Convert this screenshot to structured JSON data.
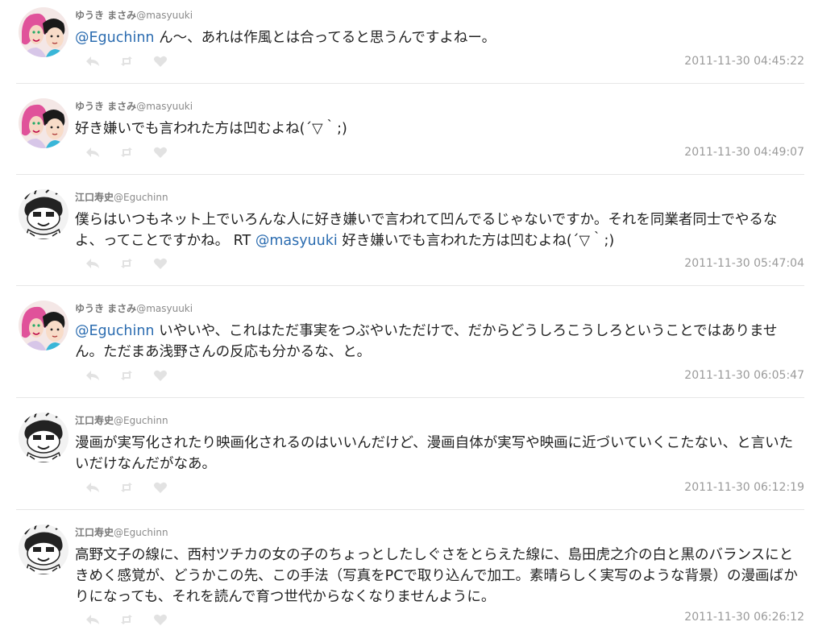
{
  "tweets": [
    {
      "name": "ゆうき まさみ",
      "handle": "@masyuuki",
      "avatar": "masyuuki",
      "parts": [
        {
          "type": "mention",
          "text": "@Eguchinn"
        },
        {
          "type": "text",
          "text": " ん〜、あれは作風とは合ってると思うんですよねー。"
        }
      ],
      "time": "2011-11-30 04:45:22"
    },
    {
      "name": "ゆうき まさみ",
      "handle": "@masyuuki",
      "avatar": "masyuuki",
      "parts": [
        {
          "type": "text",
          "text": "好き嫌いでも言われた方は凹むよね(´▽｀;)"
        }
      ],
      "time": "2011-11-30 04:49:07"
    },
    {
      "name": "江口寿史",
      "handle": "@Eguchinn",
      "avatar": "eguchinn",
      "parts": [
        {
          "type": "text",
          "text": "僕らはいつもネット上でいろんな人に好き嫌いで言われて凹んでるじゃないですか。それを同業者同士でやるなよ、ってことですかね。 RT "
        },
        {
          "type": "mention",
          "text": "@masyuuki"
        },
        {
          "type": "text",
          "text": " 好き嫌いでも言われた方は凹むよね(´▽｀;)"
        }
      ],
      "time": "2011-11-30 05:47:04"
    },
    {
      "name": "ゆうき まさみ",
      "handle": "@masyuuki",
      "avatar": "masyuuki",
      "parts": [
        {
          "type": "mention",
          "text": "@Eguchinn"
        },
        {
          "type": "text",
          "text": " いやいや、これはただ事実をつぶやいただけで、だからどうしろこうしろということではありません。ただまあ浅野さんの反応も分かるな、と。"
        }
      ],
      "time": "2011-11-30 06:05:47"
    },
    {
      "name": "江口寿史",
      "handle": "@Eguchinn",
      "avatar": "eguchinn",
      "parts": [
        {
          "type": "text",
          "text": "漫画が実写化されたり映画化されるのはいいんだけど、漫画自体が実写や映画に近づいていくこたない、と言いたいだけなんだがなあ。"
        }
      ],
      "time": "2011-11-30 06:12:19"
    },
    {
      "name": "江口寿史",
      "handle": "@Eguchinn",
      "avatar": "eguchinn",
      "parts": [
        {
          "type": "text",
          "text": "高野文子の線に、西村ツチカの女の子のちょっとしたしぐさをとらえた線に、島田虎之介の白と黒のバランスにときめく感覚が、どうかこの先、この手法（写真をPCで取り込んで加工。素晴らしく実写のような背景）の漫画ばかりになっても、それを読んで育つ世代からなくなりませんように。"
        }
      ],
      "time": "2011-11-30 06:26:12"
    }
  ],
  "actions": {
    "reply_icon": "reply-icon",
    "retweet_icon": "retweet-icon",
    "favorite_icon": "heart-icon"
  },
  "colors": {
    "mention": "#2b6cb0",
    "meta": "#9a9a9a",
    "divider": "#e6e6e6"
  }
}
